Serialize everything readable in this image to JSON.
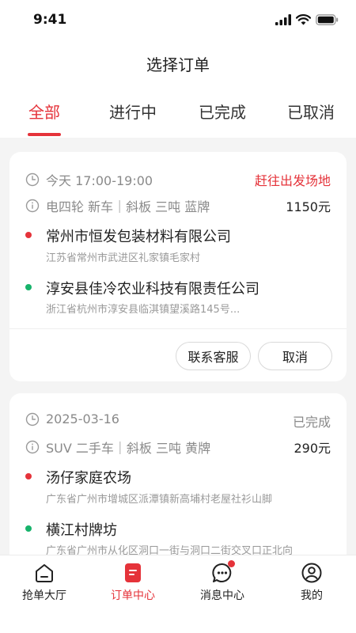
{
  "status_bar": {
    "time": "9:41"
  },
  "header": {
    "title": "选择订单"
  },
  "tabs": [
    {
      "label": "全部",
      "active": true
    },
    {
      "label": "进行中",
      "active": false
    },
    {
      "label": "已完成",
      "active": false
    },
    {
      "label": "已取消",
      "active": false
    }
  ],
  "orders": [
    {
      "time": "今天 17:00-19:00",
      "status": "赶往出发场地",
      "vehicle": "电四轮 新车｜斜板 三吨 蓝牌",
      "price": "1150元",
      "origin": {
        "name": "常州市恒发包装材料有限公司",
        "address": "江苏省常州市武进区礼家镇毛家村"
      },
      "destination": {
        "name": "淳安县佳冷农业科技有限责任公司",
        "address": "浙江省杭州市淳安县临淇镇望溪路145号..."
      },
      "actions": {
        "contact": "联系客服",
        "cancel": "取消"
      }
    },
    {
      "time": "2025-03-16",
      "status": "已完成",
      "vehicle": "SUV 二手车｜斜板 三吨 黄牌",
      "price": "290元",
      "origin": {
        "name": "汤仔家庭农场",
        "address": "广东省广州市增城区派潭镇新高埔村老屋社衫山脚"
      },
      "destination": {
        "name": "横江村牌坊",
        "address": "广东省广州市从化区洞口一街与洞口二街交叉口正北向"
      }
    }
  ],
  "tabbar": [
    {
      "label": "抢单大厅",
      "icon": "home-icon"
    },
    {
      "label": "订单中心",
      "icon": "order-icon",
      "active": true
    },
    {
      "label": "消息中心",
      "icon": "message-icon",
      "badge": true
    },
    {
      "label": "我的",
      "icon": "profile-icon"
    }
  ],
  "colors": {
    "accent": "#e5333a",
    "green": "#17b36b",
    "muted": "#8a8a8a"
  }
}
